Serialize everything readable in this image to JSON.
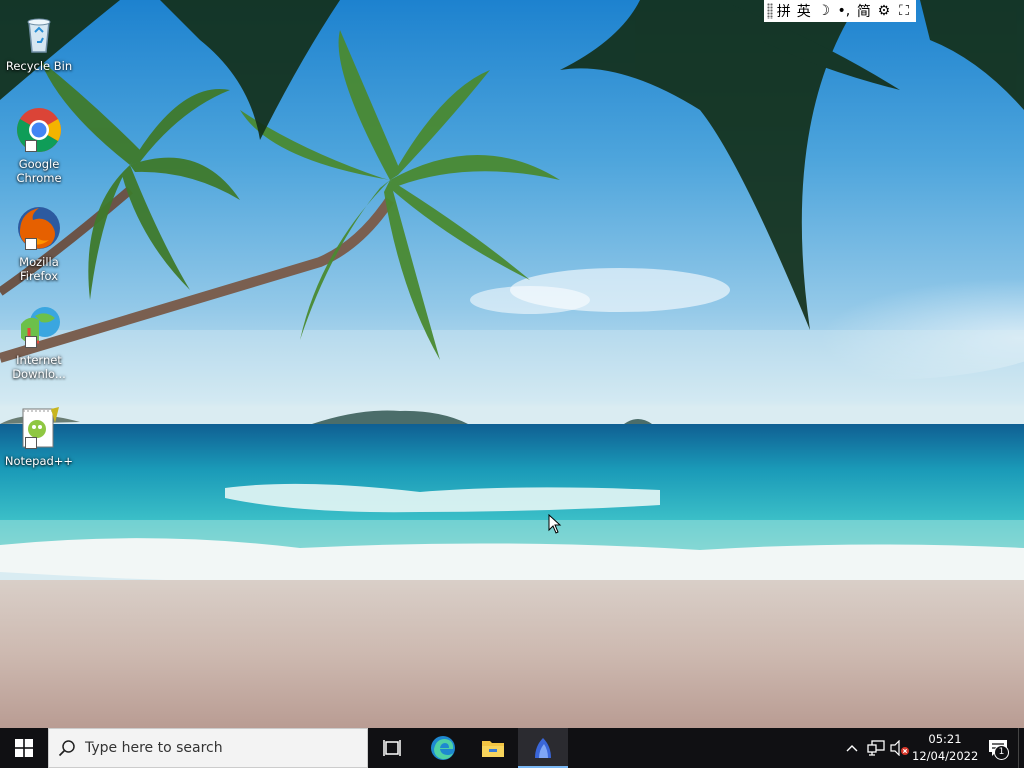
{
  "desktop": {
    "icons": [
      {
        "label": "Recycle Bin",
        "icon": "recycle-bin-icon"
      },
      {
        "label": "Google Chrome",
        "icon": "chrome-icon"
      },
      {
        "label": "Mozilla Firefox",
        "icon": "firefox-icon"
      },
      {
        "label": "Internet Downlo...",
        "icon": "idm-icon"
      },
      {
        "label": "Notepad++",
        "icon": "notepad-plus-plus-icon"
      }
    ]
  },
  "ime_toolbar": {
    "items": [
      {
        "glyph": "拼",
        "icon": "pinyin-mode-icon"
      },
      {
        "glyph": "英",
        "icon": "english-mode-icon"
      },
      {
        "glyph": "☽",
        "icon": "halfwidth-icon"
      },
      {
        "glyph": "•,",
        "icon": "punctuation-icon"
      },
      {
        "glyph": "简",
        "icon": "simplified-chinese-icon"
      },
      {
        "glyph": "⚙",
        "icon": "settings-gear-icon"
      },
      {
        "glyph": "⛶",
        "icon": "expand-icon"
      }
    ]
  },
  "taskbar": {
    "search_placeholder": "Type here to search",
    "pinned": [
      {
        "icon": "task-view-icon"
      },
      {
        "icon": "edge-icon"
      },
      {
        "icon": "file-explorer-icon"
      },
      {
        "icon": "app-icon-active"
      }
    ],
    "clock": {
      "time": "05:21",
      "date": "12/04/2022"
    },
    "notification_count": "1"
  }
}
